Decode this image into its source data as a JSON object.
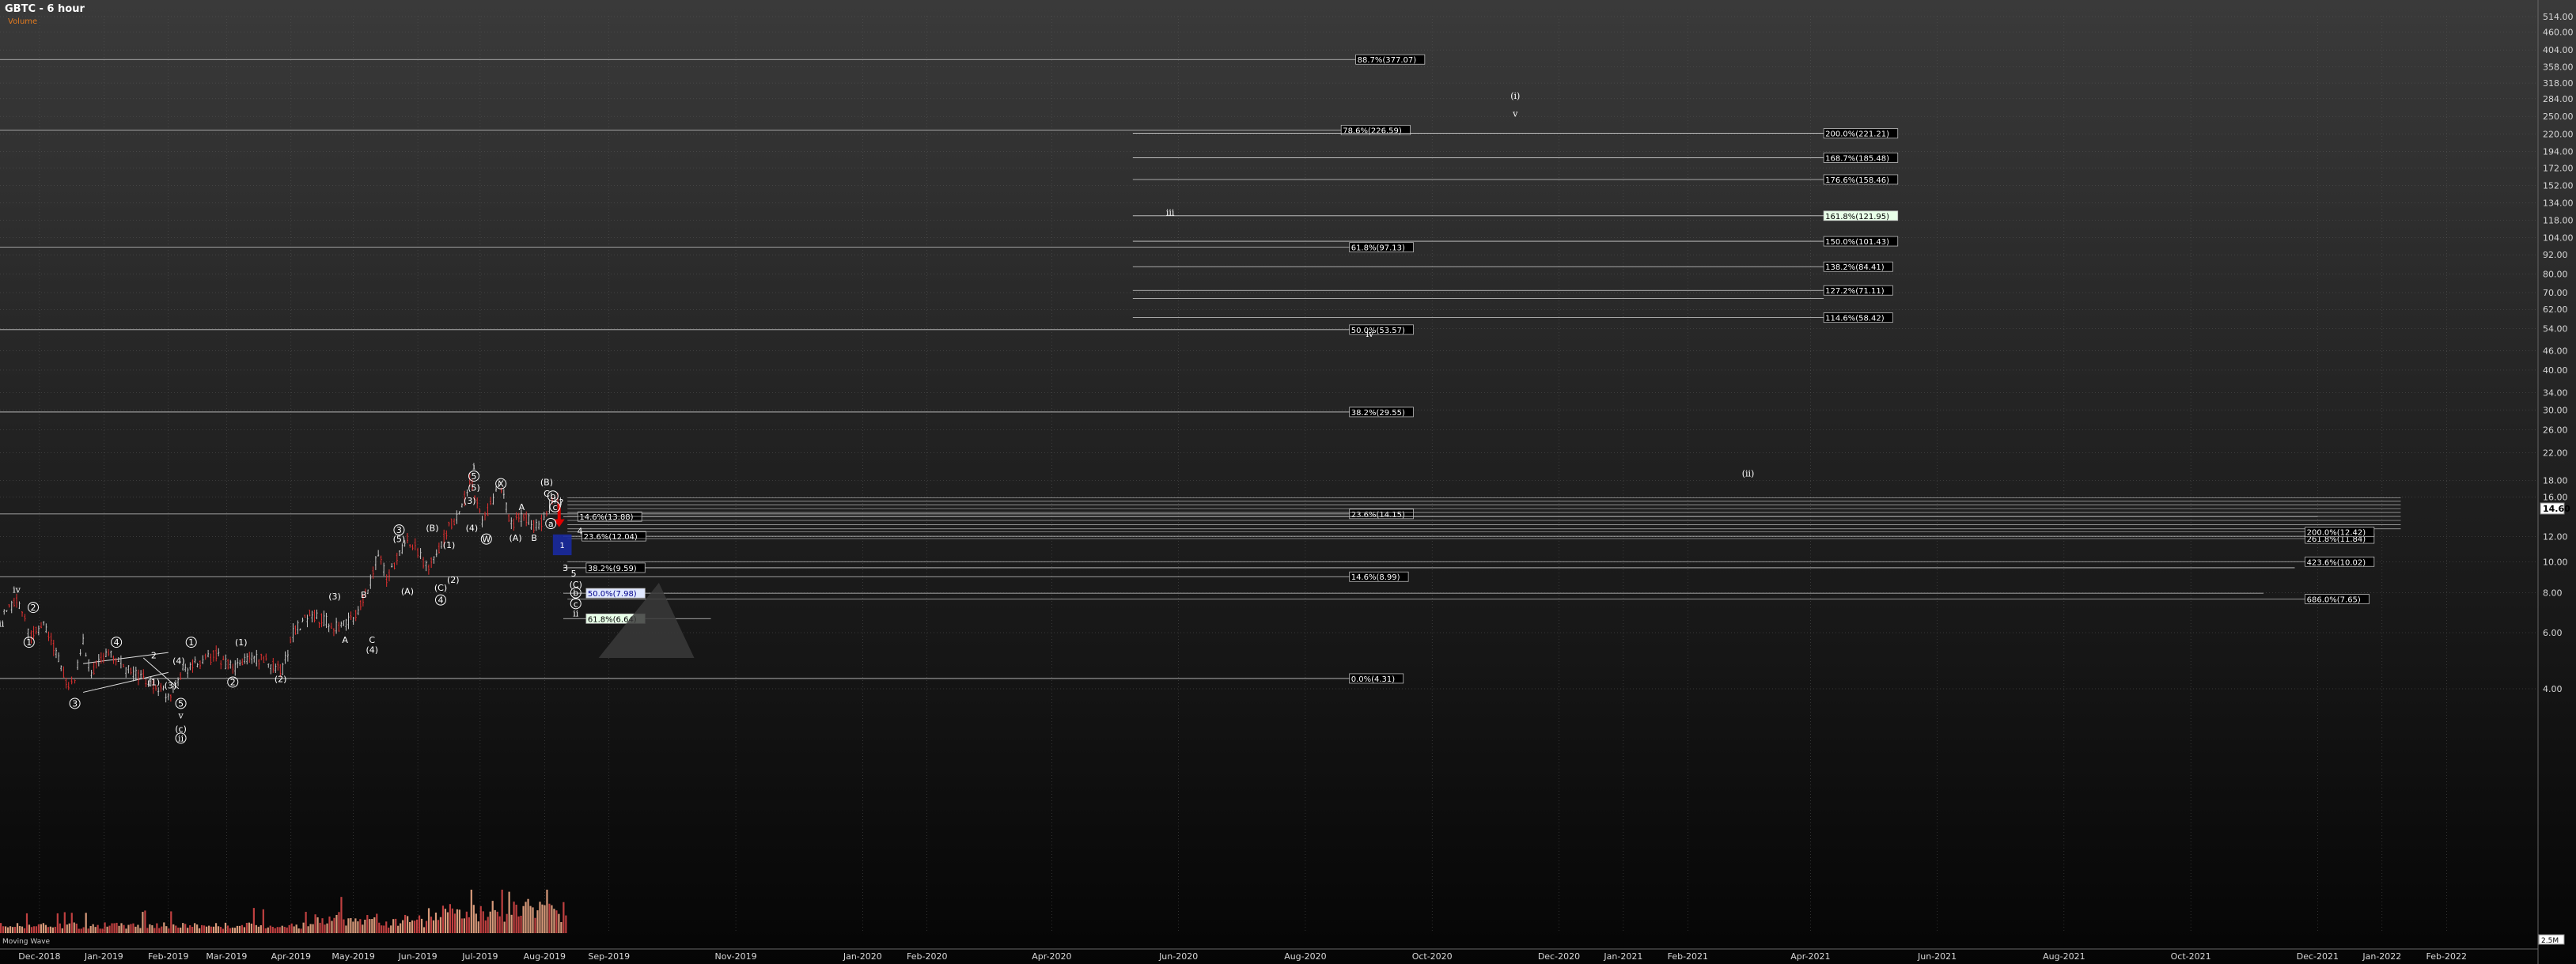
{
  "header": {
    "title": "GBTC - 6 hour",
    "subtitle": "Volume"
  },
  "volume_panel_label": "Moving Wave",
  "current_price_label": "14.60",
  "volume_scale_label": "2.5M",
  "colors": {
    "background_top": "#3a3a3a",
    "background_bottom": "#050505",
    "grid": "#5a5a5a",
    "up_candle": "#c8c8c8",
    "down_candle": "#e03030",
    "volume_up": "#d89a7a",
    "volume_down": "#c04040",
    "fib_box": "#000000",
    "highlight_green": "#e8ffe8",
    "highlight_blue": "#e0e8ff",
    "arrow_red": "#e00000",
    "target_box_blue": "#1a2aa0",
    "triangle": "#3a3a3a"
  },
  "chart_data": {
    "type": "line",
    "title": "GBTC - 6 hour",
    "y_scale": "log",
    "y_ticks": [
      "514.00",
      "460.00",
      "404.00",
      "358.00",
      "318.00",
      "284.00",
      "250.00",
      "220.00",
      "194.00",
      "172.00",
      "152.00",
      "134.00",
      "118.00",
      "104.00",
      "92.00",
      "80.00",
      "70.00",
      "62.00",
      "54.00",
      "46.00",
      "40.00",
      "34.00",
      "30.00",
      "26.00",
      "22.00",
      "18.00",
      "16.00",
      "12.00",
      "10.00",
      "8.00",
      "6.00",
      "4.00"
    ],
    "x_ticks": [
      "Dec-2018",
      "Jan-2019",
      "Feb-2019",
      "Mar-2019",
      "Apr-2019",
      "May-2019",
      "Jun-2019",
      "Jul-2019",
      "Aug-2019",
      "Sep-2019",
      "Nov-2019",
      "Jan-2020",
      "Feb-2020",
      "Apr-2020",
      "Jun-2020",
      "Aug-2020",
      "Oct-2020",
      "Dec-2020",
      "Jan-2021",
      "Feb-2021",
      "Apr-2021",
      "Jun-2021",
      "Aug-2021",
      "Oct-2021",
      "Dec-2021",
      "Jan-2022",
      "Feb-2022"
    ],
    "price_path": [
      [
        "2018-11-14",
        6.8
      ],
      [
        "2018-11-20",
        7.6
      ],
      [
        "2018-11-24",
        6.6
      ],
      [
        "2018-11-27",
        5.8
      ],
      [
        "2018-12-03",
        6.4
      ],
      [
        "2018-12-09",
        5.2
      ],
      [
        "2018-12-15",
        4.0
      ],
      [
        "2018-12-18",
        4.3
      ],
      [
        "2018-12-22",
        5.6
      ],
      [
        "2018-12-26",
        4.5
      ],
      [
        "2019-01-02",
        5.2
      ],
      [
        "2019-01-08",
        4.9
      ],
      [
        "2019-01-14",
        4.5
      ],
      [
        "2019-01-20",
        4.3
      ],
      [
        "2019-01-26",
        4.1
      ],
      [
        "2019-02-01",
        3.8
      ],
      [
        "2019-02-08",
        4.6
      ],
      [
        "2019-02-15",
        4.8
      ],
      [
        "2019-02-24",
        5.1
      ],
      [
        "2019-03-04",
        4.6
      ],
      [
        "2019-03-12",
        5.0
      ],
      [
        "2019-03-20",
        4.9
      ],
      [
        "2019-03-28",
        4.6
      ],
      [
        "2019-04-02",
        6.0
      ],
      [
        "2019-04-10",
        6.9
      ],
      [
        "2019-04-18",
        6.5
      ],
      [
        "2019-04-24",
        6.2
      ],
      [
        "2019-05-01",
        6.6
      ],
      [
        "2019-05-08",
        8.2
      ],
      [
        "2019-05-13",
        10.8
      ],
      [
        "2019-05-17",
        8.7
      ],
      [
        "2019-05-22",
        10.4
      ],
      [
        "2019-05-27",
        11.8
      ],
      [
        "2019-06-01",
        10.9
      ],
      [
        "2019-06-05",
        9.6
      ],
      [
        "2019-06-10",
        10.5
      ],
      [
        "2019-06-16",
        12.8
      ],
      [
        "2019-06-21",
        14.2
      ],
      [
        "2019-06-26",
        18.2
      ],
      [
        "2019-07-02",
        13.6
      ],
      [
        "2019-07-06",
        15.0
      ],
      [
        "2019-07-10",
        17.6
      ],
      [
        "2019-07-16",
        13.2
      ],
      [
        "2019-07-22",
        14.0
      ],
      [
        "2019-07-28",
        12.8
      ],
      [
        "2019-08-02",
        13.9
      ],
      [
        "2019-08-06",
        16.2
      ],
      [
        "2019-08-10",
        14.7
      ]
    ],
    "wave_labels": [
      {
        "t": "iii",
        "x": "2018-11-12",
        "y": 6.4,
        "font": "serif"
      },
      {
        "t": "iv",
        "x": "2018-11-20",
        "y": 8.2,
        "font": "serif"
      },
      {
        "t": "1",
        "x": "2018-11-26",
        "y": 5.6,
        "circled": true
      },
      {
        "t": "2",
        "x": "2018-11-28",
        "y": 7.2,
        "circled": true
      },
      {
        "t": "3",
        "x": "2018-12-18",
        "y": 3.6,
        "circled": true
      },
      {
        "t": "4",
        "x": "2019-01-07",
        "y": 5.6,
        "circled": true
      },
      {
        "t": "2",
        "x": "2019-01-25",
        "y": 5.1
      },
      {
        "t": "(1)",
        "x": "2019-01-25",
        "y": 4.2
      },
      {
        "t": "(3)",
        "x": "2019-02-02",
        "y": 4.1
      },
      {
        "t": "(4)",
        "x": "2019-02-06",
        "y": 4.9
      },
      {
        "t": "5",
        "x": "2019-02-07",
        "y": 3.6,
        "circled": true
      },
      {
        "t": "v",
        "x": "2019-02-07",
        "y": 3.3,
        "font": "serif"
      },
      {
        "t": "(c)",
        "x": "2019-02-07",
        "y": 3.0
      },
      {
        "t": "ii",
        "x": "2019-02-07",
        "y": 2.8,
        "circled": true,
        "font": "serif"
      },
      {
        "t": "1",
        "x": "2019-02-12",
        "y": 5.6,
        "circled": true
      },
      {
        "t": "(1)",
        "x": "2019-03-08",
        "y": 5.6
      },
      {
        "t": "2",
        "x": "2019-03-04",
        "y": 4.2,
        "circled": true
      },
      {
        "t": "(2)",
        "x": "2019-03-27",
        "y": 4.3
      },
      {
        "t": "(3)",
        "x": "2019-04-22",
        "y": 7.8
      },
      {
        "t": "A",
        "x": "2019-04-27",
        "y": 5.7
      },
      {
        "t": "B",
        "x": "2019-05-06",
        "y": 7.9
      },
      {
        "t": "C",
        "x": "2019-05-10",
        "y": 5.7
      },
      {
        "t": "(4)",
        "x": "2019-05-10",
        "y": 5.3
      },
      {
        "t": "3",
        "x": "2019-05-23",
        "y": 12.6,
        "circled": true
      },
      {
        "t": "(5)",
        "x": "2019-05-23",
        "y": 11.8
      },
      {
        "t": "(A)",
        "x": "2019-05-27",
        "y": 8.1
      },
      {
        "t": "(B)",
        "x": "2019-06-08",
        "y": 12.8
      },
      {
        "t": "(1)",
        "x": "2019-06-16",
        "y": 11.3
      },
      {
        "t": "(C)",
        "x": "2019-06-12",
        "y": 8.3
      },
      {
        "t": "4",
        "x": "2019-06-12",
        "y": 7.6,
        "circled": true
      },
      {
        "t": "(2)",
        "x": "2019-06-18",
        "y": 8.8
      },
      {
        "t": "(4)",
        "x": "2019-06-27",
        "y": 12.8
      },
      {
        "t": "(3)",
        "x": "2019-06-26",
        "y": 15.6
      },
      {
        "t": "(5)",
        "x": "2019-06-28",
        "y": 17.1
      },
      {
        "t": "5",
        "x": "2019-06-28",
        "y": 18.6,
        "circled": true
      },
      {
        "t": "i",
        "x": "2019-06-28",
        "y": 20.0,
        "font": "serif"
      },
      {
        "t": "W",
        "x": "2019-07-04",
        "y": 11.8,
        "circled": true
      },
      {
        "t": "X",
        "x": "2019-07-11",
        "y": 17.6,
        "circled": true
      },
      {
        "t": "A",
        "x": "2019-07-21",
        "y": 14.9
      },
      {
        "t": "(A)",
        "x": "2019-07-18",
        "y": 11.9
      },
      {
        "t": "B",
        "x": "2019-07-27",
        "y": 11.9
      },
      {
        "t": "(B)",
        "x": "2019-08-02",
        "y": 17.8
      },
      {
        "t": "C",
        "x": "2019-08-02",
        "y": 16.4
      },
      {
        "t": "b",
        "x": "2019-08-05",
        "y": 16.1,
        "circled": true
      },
      {
        "t": "a",
        "x": "2019-08-04",
        "y": 13.2,
        "circled": true
      },
      {
        "t": "c",
        "x": "2019-08-06",
        "y": 14.9,
        "circled": true
      },
      {
        "t": "?",
        "x": "2019-08-09",
        "y": 15.4
      },
      {
        "t": "4",
        "x": "2019-08-18",
        "y": 12.5
      },
      {
        "t": "3",
        "x": "2019-08-11",
        "y": 9.6
      },
      {
        "t": "5",
        "x": "2019-08-15",
        "y": 9.2
      },
      {
        "t": "(C)",
        "x": "2019-08-16",
        "y": 8.5
      },
      {
        "t": "b",
        "x": "2019-08-16",
        "y": 8.0,
        "circled": true
      },
      {
        "t": "c",
        "x": "2019-08-16",
        "y": 7.4,
        "circled": true
      },
      {
        "t": "ii",
        "x": "2019-08-16",
        "y": 6.9,
        "font": "serif"
      },
      {
        "t": "iii",
        "x": "2020-05-28",
        "y": 125,
        "font": "serif"
      },
      {
        "t": "iv",
        "x": "2020-09-01",
        "y": 52,
        "font": "serif"
      },
      {
        "t": "(i)",
        "x": "2020-11-10",
        "y": 290,
        "font": "serif"
      },
      {
        "t": "v",
        "x": "2020-11-10",
        "y": 255,
        "font": "serif"
      },
      {
        "t": "(ii)",
        "x": "2021-03-02",
        "y": 19.0,
        "font": "serif"
      }
    ],
    "fib_levels": [
      {
        "label": "88.7%(377.07)",
        "price": 377.07,
        "line_from": "2018-11-12",
        "box_at": "2020-08-26",
        "line_to": "2020-08-29"
      },
      {
        "label": "78.6%(226.59)",
        "price": 226.59,
        "line_from": "2018-11-12",
        "box_at": "2020-08-19",
        "line_to": "2020-08-22"
      },
      {
        "label": "61.8%(97.13)",
        "price": 97.13,
        "line_from": "2018-11-12",
        "box_at": "2020-08-23",
        "line_to": "2020-09-25"
      },
      {
        "label": "50.0%(53.57)",
        "price": 53.57,
        "line_from": "2018-11-12",
        "box_at": "2020-08-23",
        "line_to": "2020-09-25"
      },
      {
        "label": "38.2%(29.55)",
        "price": 29.55,
        "line_from": "2018-11-12",
        "box_at": "2020-08-23",
        "line_to": "2020-09-25"
      },
      {
        "label": "23.6%(14.15)",
        "price": 14.15,
        "line_from": "2018-11-12",
        "box_at": "2020-08-23",
        "line_to": "2020-09-25"
      },
      {
        "label": "14.6%(8.99)",
        "price": 8.99,
        "line_from": "2018-11-12",
        "box_at": "2020-08-23",
        "line_to": "2020-09-25"
      },
      {
        "label": "0.0%(4.31)",
        "price": 4.31,
        "line_from": "2018-11-12",
        "box_at": "2020-08-23",
        "line_to": "2020-09-25"
      }
    ],
    "ext_levels": [
      {
        "label": "200.0%(221.21)",
        "price": 221.21
      },
      {
        "label": "168.7%(185.48)",
        "price": 185.48
      },
      {
        "label": "176.6%(158.46)",
        "price": 158.46
      },
      {
        "label": "161.8%(121.95)",
        "price": 121.95,
        "highlight": "green"
      },
      {
        "label": "150.0%(101.43)",
        "price": 101.43
      },
      {
        "label": "138.2%(84.41)",
        "price": 84.41
      },
      {
        "label": "127.2%(71.11)",
        "price": 71.11
      },
      {
        "label": "114.6%(58.42)",
        "price": 58.42
      }
    ],
    "ext_extra_line_price": 67.0,
    "near_levels": [
      {
        "label": "14.6%(13.88)",
        "price": 13.88,
        "box_at": "2019-08-17"
      },
      {
        "label": "23.6%(12.04)",
        "price": 12.04,
        "box_at": "2019-08-19"
      },
      {
        "label": "38.2%(9.59)",
        "price": 9.59,
        "box_at": "2019-08-21"
      },
      {
        "label": "50.0%(7.98)",
        "price": 7.98,
        "box_at": "2019-08-21",
        "highlight": "blue"
      },
      {
        "label": "61.8%(6.64)",
        "price": 6.64,
        "box_at": "2019-08-21",
        "highlight": "green"
      }
    ],
    "right_levels": [
      {
        "label": "261.8%(11.84)",
        "price": 11.84
      },
      {
        "label": "200.0%(12.42)",
        "price": 12.42
      },
      {
        "label": "423.6%(10.02)",
        "price": 10.02
      },
      {
        "label": "686.0%(7.65)",
        "price": 7.65
      }
    ],
    "right_stacked_prices": [
      15.9,
      15.5,
      15.1,
      14.7,
      14.3,
      13.9,
      13.5,
      13.1,
      12.7
    ],
    "target_box": {
      "label": "1",
      "from": "2019-08-05",
      "to": "2019-08-14",
      "top": 12.2,
      "bottom": 10.5
    },
    "red_arrow": {
      "x": "2019-08-08",
      "from": 15.2,
      "to": 13.0
    },
    "triangle": {
      "x1": "2019-08-27",
      "x2": "2019-10-12",
      "apex_x": "2019-09-25",
      "top": 8.6,
      "bottom": 5.0
    },
    "wedge_lines": [
      {
        "x1": "2018-12-22",
        "y1": 4.8,
        "x2": "2019-02-01",
        "y2": 5.2
      },
      {
        "x1": "2018-12-22",
        "y1": 3.9,
        "x2": "2019-02-01",
        "y2": 4.5
      },
      {
        "x1": "2019-01-20",
        "y1": 5.0,
        "x2": "2019-02-06",
        "y2": 4.0
      }
    ],
    "volume_bars_count": 240,
    "volume_seed": 17,
    "x_range": [
      "2018-11-12",
      "2022-03-14"
    ]
  }
}
